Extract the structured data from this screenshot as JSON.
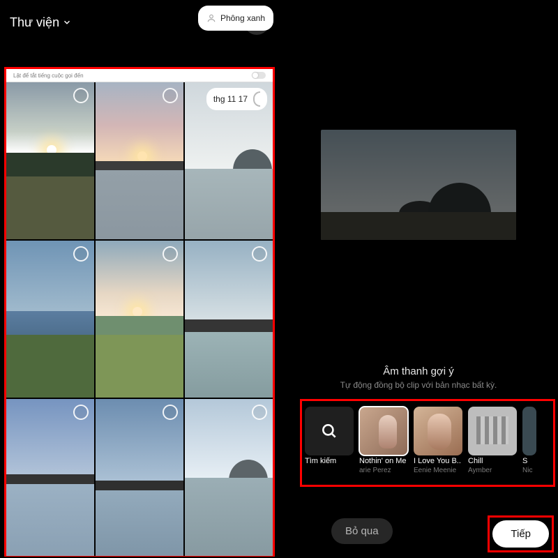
{
  "left": {
    "library_label": "Thư viện",
    "greenroom_label": "Phông xanh",
    "toggle_label": "Lật để tắt tiếng cuộc gọi đến",
    "date_pill": "thg 11 17"
  },
  "right": {
    "suggested_title": "Âm thanh gợi ý",
    "suggested_sub": "Tự động đồng bộ clip với bản nhạc bất kỳ.",
    "skip": "Bỏ qua",
    "next": "Tiếp"
  },
  "tracks": [
    {
      "title": "Tìm kiếm",
      "artist": ""
    },
    {
      "title": "Nothin' on Me",
      "artist": "arie Perez"
    },
    {
      "title": "I Love You B..",
      "artist": "Eenie Meenie"
    },
    {
      "title": "Chill",
      "artist": "Aymber"
    },
    {
      "title": "S",
      "artist": "Nic"
    }
  ]
}
